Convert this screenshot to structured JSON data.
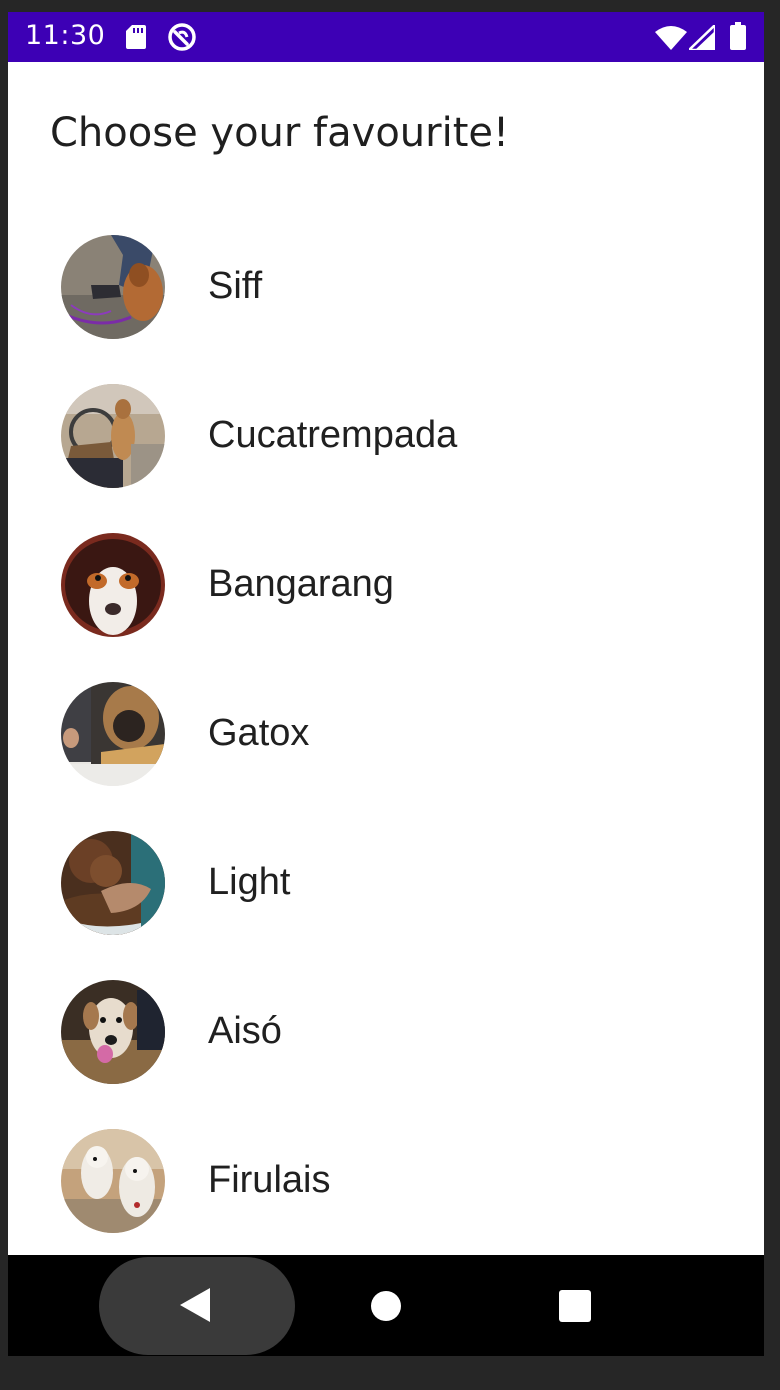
{
  "status_bar": {
    "time": "11:30",
    "background": "#3d00b5",
    "icons": [
      "sd-card-icon",
      "sync-icon",
      "wifi-icon",
      "cell-signal-icon",
      "battery-icon"
    ]
  },
  "heading": "Choose your favourite!",
  "items": [
    {
      "label": "Siff"
    },
    {
      "label": "Cucatrempada"
    },
    {
      "label": "Bangarang"
    },
    {
      "label": "Gatox"
    },
    {
      "label": "Light"
    },
    {
      "label": "Aisó"
    },
    {
      "label": "Firulais"
    }
  ],
  "nav_bar": {
    "icons": [
      "back-icon",
      "home-icon",
      "recents-icon"
    ]
  }
}
